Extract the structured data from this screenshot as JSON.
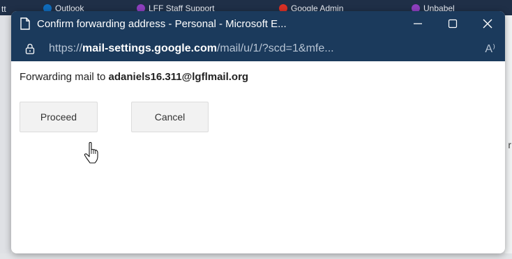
{
  "background": {
    "left_fragment": "tt",
    "right_fragment": "r",
    "tabs": [
      {
        "label": "Outlook",
        "color": "#0f6cbd"
      },
      {
        "label": "LFF Staff Support",
        "color": "#8e3fbf"
      },
      {
        "label": "Google Admin",
        "color": "#d93025"
      },
      {
        "label": "Unbabel",
        "color": "#8e3fbf"
      }
    ]
  },
  "window": {
    "title": "Confirm forwarding address - Personal - Microsoft E...",
    "controls": {
      "minimize_icon": "minimize-icon",
      "maximize_icon": "maximize-icon",
      "close_icon": "close-icon"
    }
  },
  "address_bar": {
    "scheme": "https://",
    "host": "mail-settings.google.com",
    "path": "/mail/u/1/?scd=1&mfe...",
    "read_aloud_icon": "A⁾"
  },
  "content": {
    "message_prefix": "Forwarding mail to ",
    "email": "adaniels16.311@lgflmail.org"
  },
  "buttons": {
    "proceed": "Proceed",
    "cancel": "Cancel"
  },
  "colors": {
    "titlebar": "#1b3a5c",
    "button_bg": "#f2f2f2"
  }
}
